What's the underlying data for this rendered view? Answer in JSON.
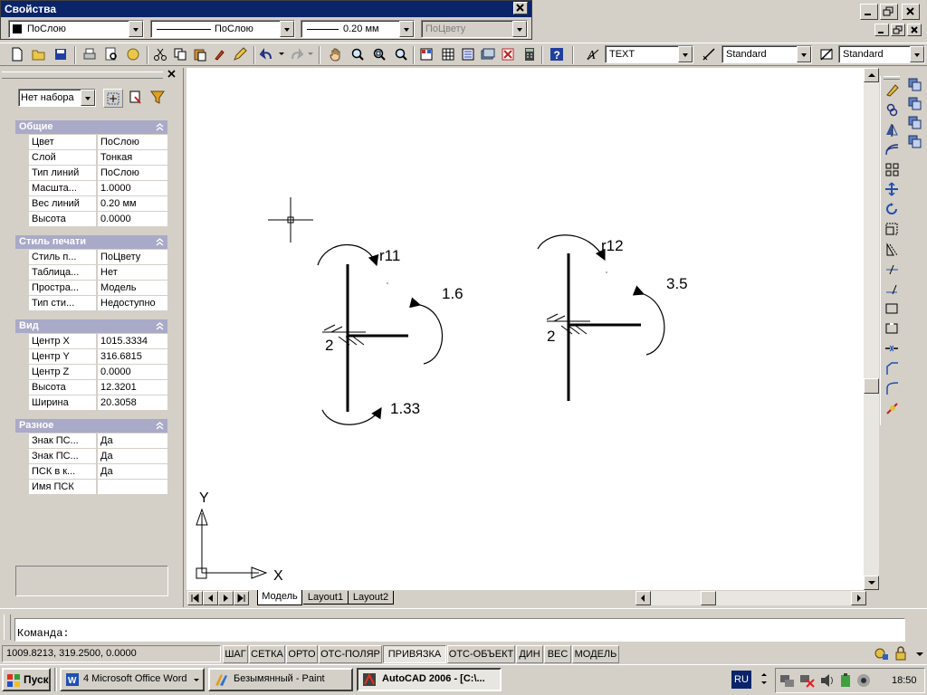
{
  "palette": {
    "accent": "#0a246a",
    "panel": "#d4d0c8",
    "category": "#a9a9c8",
    "canvas": "#ffffff",
    "taskbar": "#d4d0c8"
  },
  "props_window": {
    "title": "Свойства",
    "color_combo": "ПоСлою",
    "linetype_combo": "ПоСлою",
    "lineweight_combo": "0.20 мм",
    "plotstyle_combo": "ПоЦвету"
  },
  "toolbar": {
    "text_style": "TEXT",
    "dim_style": "Standard",
    "table_style": "Standard"
  },
  "palette_panel": {
    "selection": "Нет набора",
    "categories": [
      {
        "title": "Общие",
        "rows": [
          {
            "key": "Цвет",
            "value": "ПоСлою"
          },
          {
            "key": "Слой",
            "value": "Тонкая"
          },
          {
            "key": "Тип линий",
            "value": "ПоСлою"
          },
          {
            "key": "Масшта...",
            "value": "1.0000"
          },
          {
            "key": "Вес линий",
            "value": "0.20 мм"
          },
          {
            "key": "Высота",
            "value": "0.0000"
          }
        ]
      },
      {
        "title": "Стиль печати",
        "rows": [
          {
            "key": "Стиль п...",
            "value": "ПоЦвету"
          },
          {
            "key": "Таблица...",
            "value": "Нет"
          },
          {
            "key": "Простра...",
            "value": "Модель"
          },
          {
            "key": "Тип сти...",
            "value": "Недоступно"
          }
        ]
      },
      {
        "title": "Вид",
        "rows": [
          {
            "key": "Центр X",
            "value": "1015.3334"
          },
          {
            "key": "Центр Y",
            "value": "316.6815"
          },
          {
            "key": "Центр Z",
            "value": "0.0000"
          },
          {
            "key": "Высота",
            "value": "12.3201"
          },
          {
            "key": "Ширина",
            "value": "20.3058"
          }
        ]
      },
      {
        "title": "Разное",
        "rows": [
          {
            "key": "Знак ПС...",
            "value": "Да"
          },
          {
            "key": "Знак ПС...",
            "value": "Да"
          },
          {
            "key": "ПСК в к...",
            "value": "Да"
          },
          {
            "key": "Имя ПСК",
            "value": ""
          }
        ]
      }
    ]
  },
  "drawing": {
    "left": {
      "radius": "r11",
      "moment_top": "1.6",
      "moment_bottom": "1.33",
      "support": "2"
    },
    "right": {
      "radius": "r12",
      "moment": "3.5",
      "support": "2"
    },
    "ucs_x": "X",
    "ucs_y": "Y"
  },
  "tabs": [
    "Модель",
    "Layout1",
    "Layout2"
  ],
  "command": {
    "prompt": "Команда:"
  },
  "status": {
    "coords": "1009.8213, 319.2500, 0.0000",
    "buttons": [
      "ШАГ",
      "СЕТКА",
      "ОРТО",
      "ОТС-ПОЛЯР",
      "ПРИВЯЗКА",
      "ОТС-ОБЪЕКТ",
      "ДИН",
      "ВЕС",
      "МОДЕЛЬ"
    ]
  },
  "taskbar": {
    "start": "Пуск",
    "tasks": [
      {
        "label": "4 Microsoft Office Word"
      },
      {
        "label": "Безымянный - Paint"
      },
      {
        "label": "AutoCAD 2006 - [C:\\..."
      }
    ],
    "lang": "RU",
    "clock": "18:50"
  }
}
